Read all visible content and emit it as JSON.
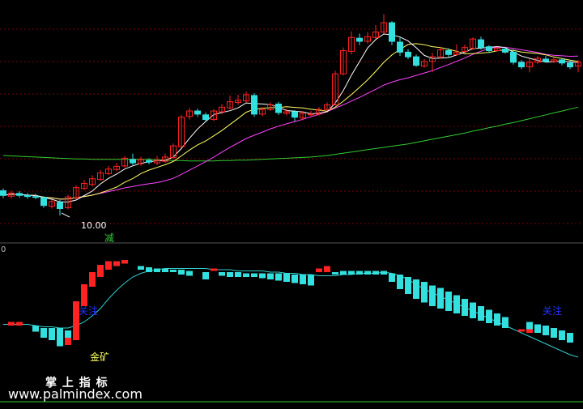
{
  "colors": {
    "background": "#000000",
    "grid": "#7a0000",
    "up": "#ff2222",
    "down": "#33e0e0",
    "ma5": "#ffffff",
    "ma10": "#ffff66",
    "ma20": "#ff44ff",
    "ma60": "#33cc33",
    "lower_line": "#33cccc",
    "label_blue": "#2233ff",
    "label_yellow": "#ffff66",
    "label_white": "#ffffff",
    "label_green": "#33cc33"
  },
  "chart_data": [
    {
      "type": "candlestick",
      "panel": "price",
      "title": "",
      "ylim": [
        9.5,
        15.4
      ],
      "low_marker": {
        "index": 7,
        "text": "10.00"
      },
      "signal_label": "减",
      "candles": [
        [
          10.64,
          10.52,
          10.7,
          10.45
        ],
        [
          10.5,
          10.58,
          10.64,
          10.44
        ],
        [
          10.57,
          10.52,
          10.63,
          10.46
        ],
        [
          10.52,
          10.49,
          10.58,
          10.43
        ],
        [
          10.49,
          10.47,
          10.56,
          10.42
        ],
        [
          10.46,
          10.26,
          10.5,
          10.2
        ],
        [
          10.24,
          10.36,
          10.41,
          10.18
        ],
        [
          10.34,
          10.18,
          10.4,
          10.0
        ],
        [
          10.2,
          10.48,
          10.53,
          10.16
        ],
        [
          10.46,
          10.72,
          10.78,
          10.42
        ],
        [
          10.7,
          10.83,
          10.92,
          10.66
        ],
        [
          10.8,
          10.95,
          11.04,
          10.75
        ],
        [
          10.93,
          11.1,
          11.18,
          10.9
        ],
        [
          11.08,
          11.2,
          11.28,
          11.05
        ],
        [
          11.19,
          11.27,
          11.36,
          11.14
        ],
        [
          11.28,
          11.48,
          11.54,
          11.24
        ],
        [
          11.45,
          11.36,
          11.6,
          11.3
        ],
        [
          11.34,
          11.44,
          11.52,
          11.28
        ],
        [
          11.42,
          11.38,
          11.48,
          11.32
        ],
        [
          11.36,
          11.42,
          11.54,
          11.3
        ],
        [
          11.4,
          11.51,
          11.6,
          11.36
        ],
        [
          11.5,
          11.8,
          11.86,
          11.46
        ],
        [
          11.78,
          12.54,
          12.6,
          11.75
        ],
        [
          12.56,
          12.7,
          12.78,
          12.48
        ],
        [
          12.7,
          12.62,
          12.76,
          12.55
        ],
        [
          12.6,
          12.48,
          12.66,
          12.42
        ],
        [
          12.48,
          12.7,
          12.75,
          12.44
        ],
        [
          12.68,
          12.8,
          12.88,
          12.62
        ],
        [
          12.78,
          12.94,
          13.1,
          12.74
        ],
        [
          12.92,
          12.98,
          13.12,
          12.86
        ],
        [
          12.96,
          13.12,
          13.2,
          12.92
        ],
        [
          13.1,
          12.62,
          13.16,
          12.55
        ],
        [
          12.62,
          12.74,
          12.8,
          12.56
        ],
        [
          12.74,
          12.86,
          12.92,
          12.7
        ],
        [
          12.88,
          12.66,
          12.94,
          12.6
        ],
        [
          12.64,
          12.68,
          12.76,
          12.58
        ],
        [
          12.68,
          12.54,
          12.72,
          12.44
        ],
        [
          12.52,
          12.64,
          12.7,
          12.46
        ],
        [
          12.62,
          12.62,
          12.7,
          12.56
        ],
        [
          12.62,
          12.74,
          12.8,
          12.58
        ],
        [
          12.74,
          12.86,
          12.92,
          12.7
        ],
        [
          12.86,
          13.66,
          13.74,
          12.84
        ],
        [
          13.66,
          14.26,
          14.34,
          13.62
        ],
        [
          14.24,
          14.6,
          14.76,
          14.16
        ],
        [
          14.58,
          14.5,
          14.7,
          14.4
        ],
        [
          14.5,
          14.62,
          14.74,
          14.44
        ],
        [
          14.6,
          14.74,
          14.92,
          14.56
        ],
        [
          14.74,
          14.98,
          15.2,
          14.7
        ],
        [
          14.98,
          14.5,
          15.02,
          14.4
        ],
        [
          14.48,
          14.22,
          14.6,
          14.12
        ],
        [
          14.22,
          14.1,
          14.3,
          14.04
        ],
        [
          14.1,
          13.88,
          14.16,
          13.84
        ],
        [
          13.86,
          13.98,
          14.04,
          13.82
        ],
        [
          13.98,
          14.1,
          14.2,
          13.7
        ],
        [
          14.1,
          14.28,
          14.34,
          14.05
        ],
        [
          14.26,
          14.16,
          14.32,
          14.1
        ],
        [
          14.16,
          14.22,
          14.42,
          14.12
        ],
        [
          14.24,
          14.34,
          14.42,
          14.2
        ],
        [
          14.32,
          14.56,
          14.6,
          14.28
        ],
        [
          14.54,
          14.34,
          14.62,
          14.28
        ],
        [
          14.36,
          14.26,
          14.4,
          14.2
        ],
        [
          14.26,
          14.32,
          14.36,
          14.24
        ],
        [
          14.3,
          14.22,
          14.36,
          14.18
        ],
        [
          14.22,
          13.96,
          14.3,
          13.9
        ],
        [
          13.96,
          13.84,
          14.02,
          13.78
        ],
        [
          13.84,
          13.96,
          14.04,
          13.7
        ],
        [
          13.96,
          14.06,
          14.12,
          13.92
        ],
        [
          14.04,
          13.98,
          14.12,
          13.96
        ],
        [
          13.98,
          14.02,
          14.08,
          13.94
        ],
        [
          14.02,
          13.94,
          14.06,
          13.88
        ],
        [
          13.94,
          13.84,
          14.0,
          13.78
        ],
        [
          13.86,
          13.96,
          14.02,
          13.7
        ]
      ],
      "ma60": [
        11.55,
        11.54,
        11.53,
        11.52,
        11.51,
        11.5,
        11.49,
        11.48,
        11.47,
        11.46,
        11.46,
        11.45,
        11.45,
        11.45,
        11.45,
        11.45,
        11.45,
        11.45,
        11.45,
        11.44,
        11.43,
        11.42,
        11.42,
        11.41,
        11.41,
        11.41,
        11.41,
        11.42,
        11.42,
        11.43,
        11.43,
        11.44,
        11.45,
        11.46,
        11.47,
        11.48,
        11.49,
        11.5,
        11.51,
        11.53,
        11.55,
        11.58,
        11.61,
        11.64,
        11.67,
        11.7,
        11.73,
        11.76,
        11.79,
        11.82,
        11.85,
        11.89,
        11.93,
        11.97,
        12.01,
        12.05,
        12.09,
        12.13,
        12.18,
        12.22,
        12.27,
        12.31,
        12.36,
        12.4,
        12.45,
        12.5,
        12.55,
        12.6,
        12.65,
        12.7,
        12.75,
        12.8
      ]
    },
    {
      "type": "bar",
      "panel": "indicator",
      "title": "",
      "ylim": [
        0,
        100
      ],
      "labels": {
        "top": "关注",
        "bottom": "金矿",
        "right": "关注"
      },
      "curve": [
        45,
        45,
        45,
        45,
        44,
        43,
        43,
        42,
        42,
        44,
        47,
        52,
        58,
        66,
        73,
        79,
        84,
        87,
        89,
        90,
        91,
        91,
        91,
        91,
        91,
        91,
        90,
        90,
        90,
        89,
        89,
        89,
        89,
        88,
        88,
        87,
        87,
        86,
        86,
        85,
        85,
        85,
        86,
        86,
        87,
        87,
        87,
        88,
        87,
        85,
        82,
        78,
        74,
        71,
        68,
        65,
        62,
        59,
        56,
        53,
        50,
        47,
        44,
        41,
        38,
        35,
        32,
        29,
        26,
        23,
        20,
        18
      ],
      "up": [
        null,
        [
          44,
          47
        ],
        [
          44,
          47
        ],
        null,
        null,
        null,
        null,
        null,
        [
          28,
          34
        ],
        [
          32,
          64
        ],
        [
          60,
          78
        ],
        [
          76,
          88
        ],
        [
          84,
          94
        ],
        [
          90,
          97
        ],
        [
          93,
          97
        ],
        [
          95,
          98
        ],
        [
          null,
          null
        ],
        null,
        null,
        null,
        null,
        null,
        null,
        null,
        null,
        null,
        [
          89,
          91
        ],
        null,
        null,
        null,
        null,
        null,
        null,
        null,
        null,
        null,
        null,
        null,
        null,
        [
          88,
          91
        ],
        [
          88,
          93
        ],
        null,
        null,
        null,
        null,
        null,
        null,
        null,
        null,
        null,
        null,
        null,
        null,
        null,
        null,
        null,
        null,
        null,
        null,
        null,
        null,
        null,
        null,
        null,
        [
          39,
          41
        ],
        [
          38,
          41
        ],
        null,
        null,
        null,
        null,
        null,
        null
      ],
      "down": [
        null,
        null,
        null,
        null,
        [
          39,
          44
        ],
        [
          34,
          42
        ],
        [
          32,
          42
        ],
        [
          27,
          42
        ],
        [
          30,
          40
        ],
        null,
        null,
        null,
        null,
        null,
        null,
        null,
        null,
        [
          90,
          93
        ],
        [
          88,
          92
        ],
        [
          88,
          91
        ],
        [
          88,
          91
        ],
        [
          88,
          90
        ],
        [
          86,
          90
        ],
        [
          85,
          89
        ],
        null,
        [
          82,
          88
        ],
        null,
        [
          85,
          88
        ],
        [
          84,
          88
        ],
        [
          84,
          88
        ],
        [
          84,
          87
        ],
        [
          84,
          87
        ],
        [
          83,
          87
        ],
        [
          82,
          87
        ],
        [
          81,
          87
        ],
        [
          80,
          87
        ],
        [
          79,
          86
        ],
        [
          78,
          86
        ],
        [
          77,
          86
        ],
        null,
        null,
        [
          86,
          88
        ],
        [
          86,
          89
        ],
        [
          86,
          89
        ],
        [
          86,
          89
        ],
        [
          86,
          89
        ],
        [
          86,
          89
        ],
        [
          86,
          89
        ],
        [
          80,
          87
        ],
        [
          74,
          86
        ],
        [
          70,
          84
        ],
        [
          66,
          82
        ],
        [
          63,
          80
        ],
        [
          60,
          77
        ],
        [
          58,
          75
        ],
        [
          56,
          72
        ],
        [
          54,
          69
        ],
        [
          52,
          66
        ],
        [
          50,
          63
        ],
        [
          48,
          60
        ],
        [
          46,
          57
        ],
        [
          44,
          54
        ],
        [
          42,
          51
        ],
        null,
        null,
        [
          40,
          47
        ],
        [
          38,
          45
        ],
        [
          36,
          44
        ],
        [
          34,
          42
        ],
        [
          32,
          40
        ],
        [
          30,
          38
        ]
      ]
    }
  ],
  "watermark": {
    "title": "掌 上 指 标",
    "url": "www.palmindex.com"
  },
  "axis_marker": "0"
}
